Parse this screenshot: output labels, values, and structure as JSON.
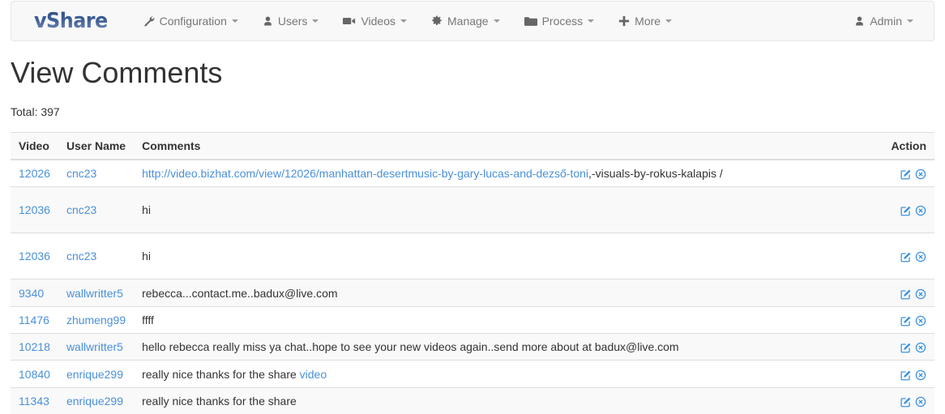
{
  "navbar": {
    "brand": "vShare",
    "items": [
      {
        "label": "Configuration",
        "icon": "wrench-icon",
        "caret": true
      },
      {
        "label": "Users",
        "icon": "user-icon",
        "caret": true
      },
      {
        "label": "Videos",
        "icon": "video-camera-icon",
        "caret": true
      },
      {
        "label": "Manage",
        "icon": "gear-icon",
        "caret": true
      },
      {
        "label": "Process",
        "icon": "folder-icon",
        "caret": true
      },
      {
        "label": "More",
        "icon": "plus-icon",
        "caret": true
      }
    ],
    "account": {
      "label": "Admin",
      "icon": "user-icon",
      "caret": true
    }
  },
  "page": {
    "title": "View Comments",
    "total_label": "Total: 397"
  },
  "table": {
    "headers": {
      "video": "Video",
      "user": "User Name",
      "comments": "Comments",
      "action": "Action"
    },
    "action_icons": {
      "edit": "edit-square-icon",
      "delete": "delete-circle-icon"
    },
    "rows": [
      {
        "video": "12026",
        "user": "cnc23",
        "comment_link": "http://video.bizhat.com/view/12026/manhattan-desertmusic-by-gary-lucas-and-dezső-toni",
        "comment_text": ",-visuals-by-rokus-kalapis /",
        "striped": false,
        "tall": false
      },
      {
        "video": "12036",
        "user": "cnc23",
        "comment_link": "",
        "comment_text": "hi",
        "striped": true,
        "tall": true
      },
      {
        "video": "12036",
        "user": "cnc23",
        "comment_link": "",
        "comment_text": "hi",
        "striped": false,
        "tall": true
      },
      {
        "video": "9340",
        "user": "wallwritter5",
        "comment_link": "",
        "comment_text": "rebecca...contact.me..badux@live.com",
        "striped": true,
        "tall": false
      },
      {
        "video": "11476",
        "user": "zhumeng99",
        "comment_link": "",
        "comment_text": "ffff",
        "striped": false,
        "tall": false
      },
      {
        "video": "10218",
        "user": "wallwritter5",
        "comment_link": "",
        "comment_text": "hello rebecca really miss ya chat..hope to see your new videos again..send more about at badux@live.com",
        "striped": true,
        "tall": false
      },
      {
        "video": "10840",
        "user": "enrique299",
        "comment_link": "",
        "comment_text": "really nice thanks for the share ",
        "comment_trailing_link": "video",
        "striped": false,
        "tall": false
      },
      {
        "video": "11343",
        "user": "enrique299",
        "comment_link": "",
        "comment_text": "really nice thanks for the share",
        "striped": true,
        "tall": false
      }
    ]
  },
  "colors": {
    "brand": "#2b4a84",
    "link": "#4a90d9",
    "action_icon": "#3c93e0",
    "navbar_bg": "#f8f8f8",
    "stripe": "#f9f9f9"
  }
}
